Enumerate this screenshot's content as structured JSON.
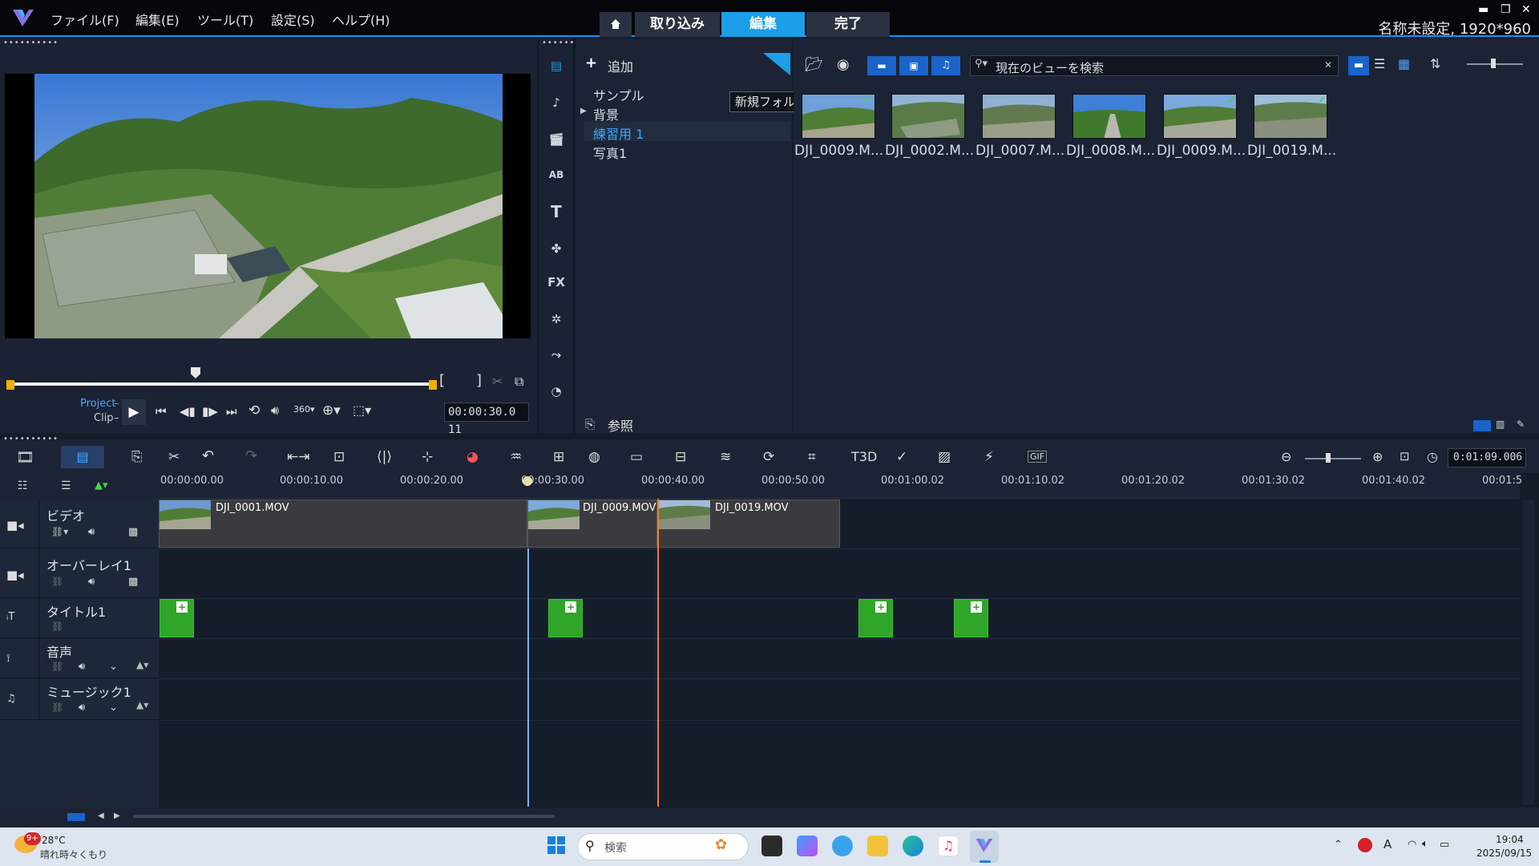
{
  "menu": [
    "ファイル(F)",
    "編集(E)",
    "ツール(T)",
    "設定(S)",
    "ヘルプ(H)"
  ],
  "nav_tabs": [
    "取り込み",
    "編集",
    "完了"
  ],
  "active_tab": "編集",
  "project_info": "名称未設定, 1920*960",
  "preview": {
    "project_label": "Project",
    "clip_label": "Clip",
    "timecode": "00:00:30.0 11"
  },
  "library": {
    "add_label": "追加",
    "tooltip": "新規フォルダーを追加",
    "search_placeholder": "現在のビューを検索",
    "folders": [
      "サンプル",
      "背景",
      "練習用 1",
      "写真1"
    ],
    "selected_folder": "練習用 1",
    "browse_label": "参照",
    "thumbnails": [
      "DJI_0009.M...",
      "DJI_0002.M...",
      "DJI_0007.M...",
      "DJI_0008.M...",
      "DJI_0009.M...",
      "DJI_0019.M..."
    ]
  },
  "timeline": {
    "total_time": "0:01:09.006",
    "ruler": [
      "00:00:00.00",
      "00:00:10.00",
      "00:00:20.00",
      "00:00:30.00",
      "00:00:40.00",
      "00:00:50.00",
      "00:01:00.02",
      "00:01:10.02",
      "00:01:20.02",
      "00:01:30.02",
      "00:01:40.02",
      "00:01:5"
    ],
    "tracks": [
      "ビデオ",
      "オーバーレイ1",
      "タイトル1",
      "音声",
      "ミュージック1"
    ],
    "clips": [
      "DJI_0001.MOV",
      "DJI_0009.MOV",
      "DJI_0019.MOV"
    ]
  },
  "taskbar": {
    "temperature": "28°C",
    "weather": "晴れ時々くもり",
    "weather_badge": "9+",
    "search": "検索",
    "time": "19:04",
    "date": "2025/09/15"
  },
  "colors": {
    "accent": "#1a9fe8",
    "title_clip": "#2fa52a",
    "playhead": "#ff7a29"
  }
}
